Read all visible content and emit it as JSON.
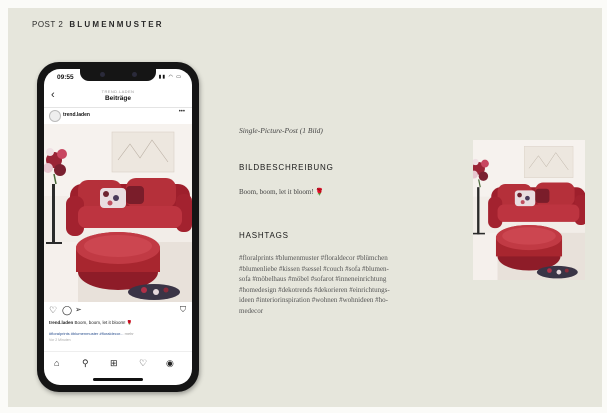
{
  "header": {
    "prefix": "POST 2",
    "title": "BLUMENMUSTER"
  },
  "phone": {
    "time": "09:55",
    "nav": {
      "back_icon": "chevron-left-icon",
      "username_small": "TREND.LADEN",
      "title": "Beiträge"
    },
    "post": {
      "username": "trend.laden",
      "caption_user": "trend.laden",
      "caption_text": "Boom, boom, let it bloom! 🌹",
      "hashtag_preview": "#floralprints #blumenmuster #floraldecor...",
      "more_label": "mehr",
      "time_ago": "Vor 2 Minuten"
    },
    "actions": [
      "heart-icon",
      "comment-icon",
      "share-icon",
      "bookmark-icon"
    ],
    "tabs": [
      "home-icon",
      "search-icon",
      "add-icon",
      "heart-icon",
      "profile-icon"
    ]
  },
  "details": {
    "post_type": "Single-Picture-Post (1 Bild)",
    "description_heading": "BILDBESCHREIBUNG",
    "description_text": "Boom, boom, let it bloom!",
    "hashtags_heading": "HASHTAGS",
    "hashtags_lines": [
      "#floralprints #blumenmuster #floraldecor #blümchen",
      "#blumenliebe #kissen #sessel #couch #sofa #blumen-",
      "sofa #möbelhaus #möbel #sofarot #inneneinrichtung",
      "#homedesign #dekotrends #dekorieren #einrichtungs-",
      "ideen #interiorinspiration #wohnen #wohnideen #ho-",
      "medecor"
    ]
  },
  "colors": {
    "background": "#e6e6dc",
    "sofa": "#b5303a",
    "hashtag_link": "#2a4f8e"
  }
}
